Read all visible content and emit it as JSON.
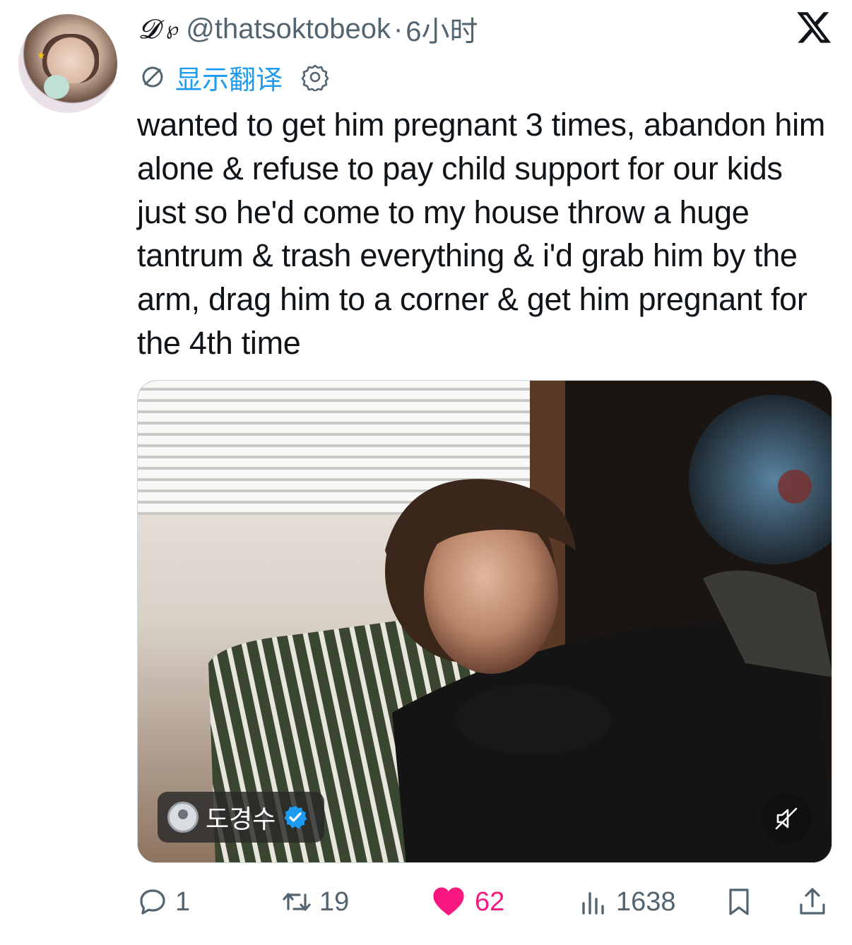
{
  "author": {
    "display_name": "𝓓",
    "display_emoji": "℘",
    "handle": "@thatsoktobeok",
    "separator": "·",
    "time": "6小时"
  },
  "translate": {
    "label": "显示翻译"
  },
  "tweet": {
    "text": "wanted to get him pregnant 3 times, abandon him alone & refuse to pay child support for our kids just so he'd come to my house throw a huge tantrum & trash everything & i'd grab him by the arm, drag him to a corner & get him pregnant for the 4th time"
  },
  "media": {
    "tag_name": "도경수"
  },
  "stats": {
    "replies": "1",
    "retweets": "19",
    "likes": "62",
    "views": "1638"
  },
  "colors": {
    "accent": "#1d9bf0",
    "like": "#f91880",
    "muted": "#536471",
    "text": "#0f1419"
  },
  "icons": {
    "close": "x-logo-icon",
    "translate": "translate-icon",
    "settings": "gear-icon",
    "verified": "verified-badge-icon",
    "mute": "muted-speaker-icon",
    "reply": "reply-icon",
    "retweet": "retweet-icon",
    "like": "heart-icon",
    "views": "views-icon",
    "bookmark": "bookmark-icon",
    "share": "share-icon"
  }
}
